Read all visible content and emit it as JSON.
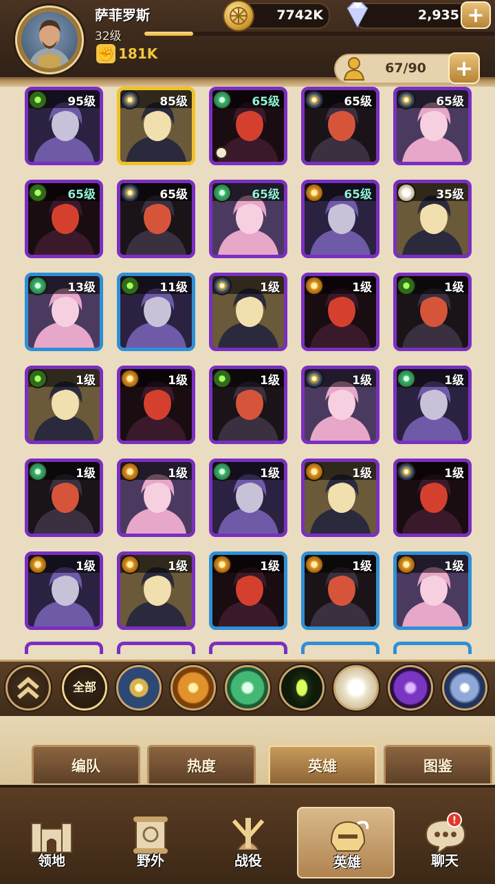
{
  "player": {
    "name": "萨菲罗斯",
    "level": "32级",
    "xp_fraction": 0.14,
    "power": "181K"
  },
  "resources": {
    "gold": "7742K",
    "gems": "2,935",
    "add_label": "+"
  },
  "capacity": {
    "value": "67/90",
    "add_label": "+"
  },
  "heroes": [
    {
      "level": "95级",
      "faction": "graveborn",
      "rarity": "purple",
      "level_color": "white",
      "timer": false
    },
    {
      "level": "85级",
      "faction": "celestial",
      "rarity": "gold",
      "level_color": "white",
      "timer": false
    },
    {
      "level": "65级",
      "faction": "wilder",
      "rarity": "purple",
      "level_color": "teal",
      "timer": true
    },
    {
      "level": "65级",
      "faction": "celestial",
      "rarity": "purple",
      "level_color": "white",
      "timer": false
    },
    {
      "level": "65级",
      "faction": "celestial",
      "rarity": "purple",
      "level_color": "white",
      "timer": false
    },
    {
      "level": "65级",
      "faction": "graveborn",
      "rarity": "purple",
      "level_color": "teal",
      "timer": false
    },
    {
      "level": "65级",
      "faction": "celestial",
      "rarity": "purple",
      "level_color": "white",
      "timer": false
    },
    {
      "level": "65级",
      "faction": "wilder",
      "rarity": "purple",
      "level_color": "teal",
      "timer": false
    },
    {
      "level": "65级",
      "faction": "light",
      "rarity": "purple",
      "level_color": "teal",
      "timer": false
    },
    {
      "level": "35级",
      "faction": "dimension",
      "rarity": "purple",
      "level_color": "white",
      "timer": false
    },
    {
      "level": "13级",
      "faction": "wilder",
      "rarity": "blue",
      "level_color": "white",
      "timer": false
    },
    {
      "level": "11级",
      "faction": "graveborn",
      "rarity": "blue",
      "level_color": "white",
      "timer": false
    },
    {
      "level": "1级",
      "faction": "celestial",
      "rarity": "purple",
      "level_color": "white",
      "timer": false
    },
    {
      "level": "1级",
      "faction": "light",
      "rarity": "purple",
      "level_color": "white",
      "timer": false
    },
    {
      "level": "1级",
      "faction": "graveborn",
      "rarity": "purple",
      "level_color": "white",
      "timer": false
    },
    {
      "level": "1级",
      "faction": "graveborn",
      "rarity": "purple",
      "level_color": "white",
      "timer": false
    },
    {
      "level": "1级",
      "faction": "light",
      "rarity": "purple",
      "level_color": "white",
      "timer": false
    },
    {
      "level": "1级",
      "faction": "graveborn",
      "rarity": "purple",
      "level_color": "white",
      "timer": false
    },
    {
      "level": "1级",
      "faction": "celestial",
      "rarity": "purple",
      "level_color": "white",
      "timer": false
    },
    {
      "level": "1级",
      "faction": "wilder",
      "rarity": "purple",
      "level_color": "white",
      "timer": false
    },
    {
      "level": "1级",
      "faction": "wilder",
      "rarity": "purple",
      "level_color": "white",
      "timer": false
    },
    {
      "level": "1级",
      "faction": "light",
      "rarity": "purple",
      "level_color": "white",
      "timer": false
    },
    {
      "level": "1级",
      "faction": "wilder",
      "rarity": "purple",
      "level_color": "white",
      "timer": false
    },
    {
      "level": "1级",
      "faction": "light",
      "rarity": "purple",
      "level_color": "white",
      "timer": false
    },
    {
      "level": "1级",
      "faction": "celestial",
      "rarity": "purple",
      "level_color": "white",
      "timer": false
    },
    {
      "level": "1级",
      "faction": "light",
      "rarity": "purple",
      "level_color": "white",
      "timer": false
    },
    {
      "level": "1级",
      "faction": "light",
      "rarity": "purple",
      "level_color": "white",
      "timer": false
    },
    {
      "level": "1级",
      "faction": "light",
      "rarity": "blue",
      "level_color": "white",
      "timer": false
    },
    {
      "level": "1级",
      "faction": "light",
      "rarity": "blue",
      "level_color": "white",
      "timer": false
    },
    {
      "level": "1级",
      "faction": "light",
      "rarity": "blue",
      "level_color": "white",
      "timer": false
    }
  ],
  "filters": {
    "all_label": "全部",
    "factions": [
      "celestial",
      "light",
      "wilder",
      "graveborn",
      "dimension",
      "hypogean",
      "mauler"
    ]
  },
  "subtabs": [
    {
      "label": "编队",
      "active": false
    },
    {
      "label": "热度",
      "active": false
    },
    {
      "label": "英雄",
      "active": true
    },
    {
      "label": "图鉴",
      "active": false
    }
  ],
  "nav": [
    {
      "label": "领地",
      "icon": "castle-icon",
      "active": false
    },
    {
      "label": "野外",
      "icon": "scroll-map-icon",
      "active": false
    },
    {
      "label": "战役",
      "icon": "crossed-swords-icon",
      "active": false
    },
    {
      "label": "英雄",
      "icon": "helmet-icon",
      "active": true
    },
    {
      "label": "聊天",
      "icon": "chat-bubble-icon",
      "active": false
    }
  ],
  "notifications": {
    "chat_badge": "!"
  },
  "colors": {
    "rarity_purple": "#7a2fc0",
    "rarity_gold": "#f0c22a",
    "rarity_blue": "#2f8fd6",
    "level_teal": "#8ff2d6",
    "accent_gold": "#f4c542"
  }
}
